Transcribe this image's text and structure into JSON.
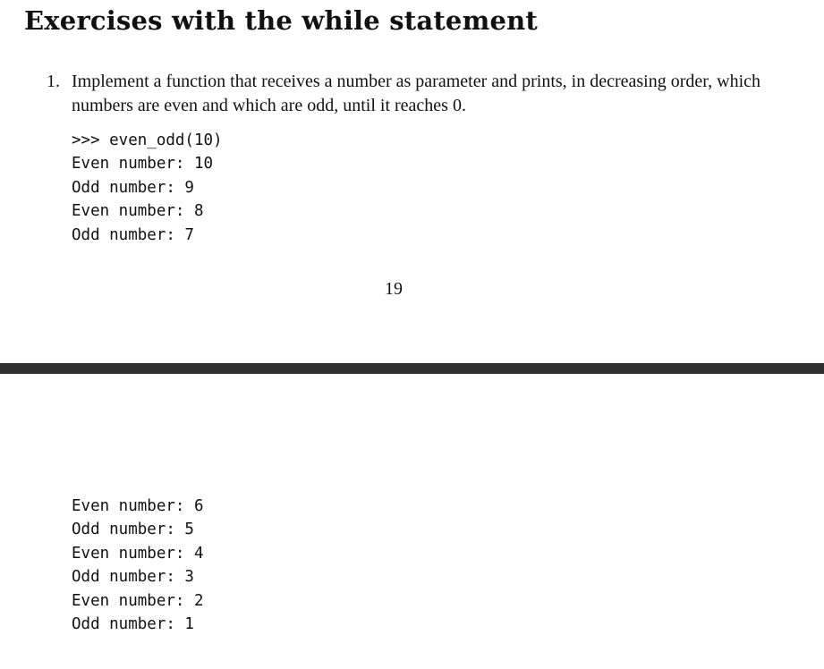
{
  "page1": {
    "section_title": "Exercises with the while statement",
    "exercise": {
      "number": "1.",
      "text": "Implement a function that receives a number as parameter and prints, in decreasing order, which numbers are even and which are odd, until it reaches 0."
    },
    "code_lines": [
      ">>> even_odd(10)",
      "Even number: 10",
      "Odd number: 9",
      "Even number: 8",
      "Odd number: 7"
    ],
    "page_number": "19"
  },
  "page2": {
    "code_lines": [
      "Even number: 6",
      "Odd number: 5",
      "Even number: 4",
      "Odd number: 3",
      "Even number: 2",
      "Odd number: 1"
    ]
  },
  "colors": {
    "page_background": "#ffffff",
    "separator": "#2e2f30",
    "text": "#111111"
  }
}
